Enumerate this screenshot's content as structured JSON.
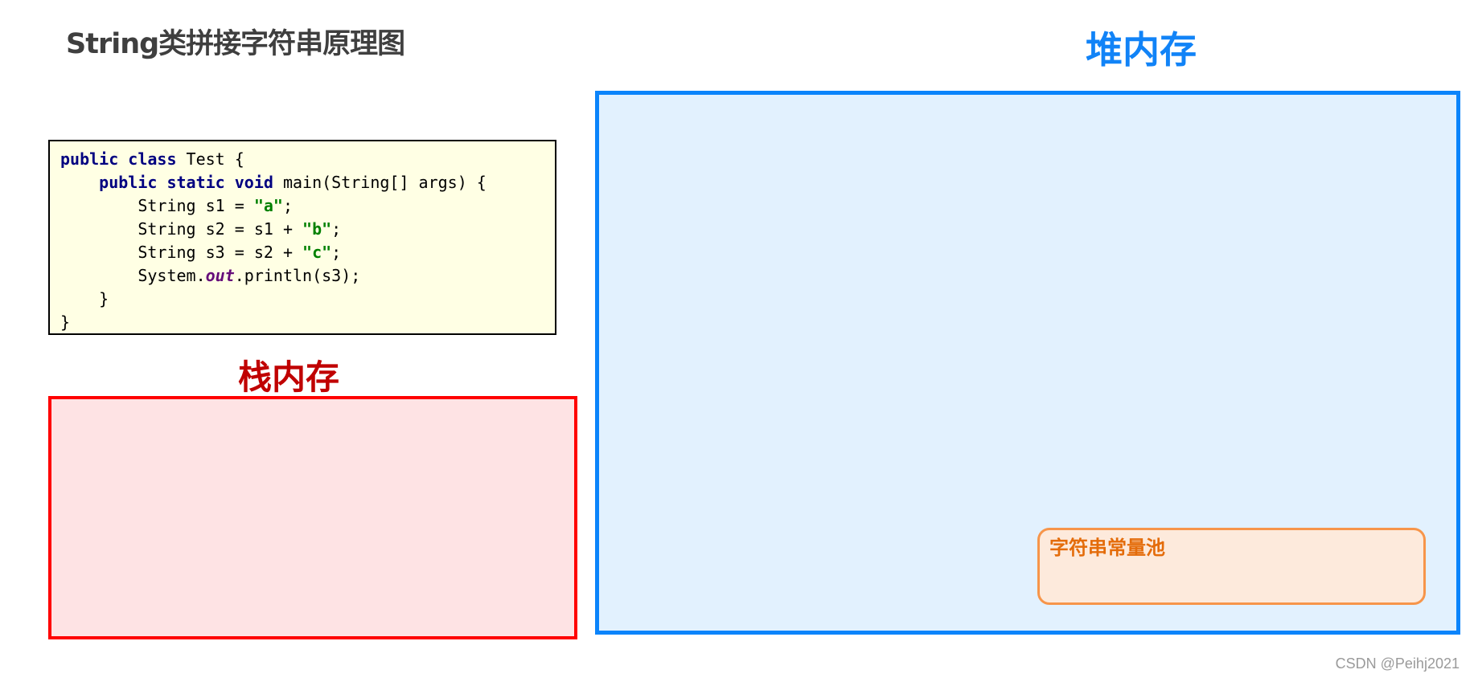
{
  "title": "String类拼接字符串原理图",
  "code": {
    "lines": [
      [
        {
          "t": "public class",
          "c": "kw"
        },
        {
          "t": " Test {",
          "c": ""
        }
      ],
      [
        {
          "t": "    ",
          "c": ""
        },
        {
          "t": "public static void",
          "c": "kw"
        },
        {
          "t": " main(String[] args) {",
          "c": ""
        }
      ],
      [
        {
          "t": "        String s1 = ",
          "c": ""
        },
        {
          "t": "\"a\"",
          "c": "str"
        },
        {
          "t": ";",
          "c": ""
        }
      ],
      [
        {
          "t": "        String s2 = s1 + ",
          "c": ""
        },
        {
          "t": "\"b\"",
          "c": "str"
        },
        {
          "t": ";",
          "c": ""
        }
      ],
      [
        {
          "t": "        String s3 = s2 + ",
          "c": ""
        },
        {
          "t": "\"c\"",
          "c": "str"
        },
        {
          "t": ";",
          "c": ""
        }
      ],
      [
        {
          "t": "        System.",
          "c": ""
        },
        {
          "t": "out",
          "c": "fld"
        },
        {
          "t": ".println(s3);",
          "c": ""
        }
      ],
      [
        {
          "t": "    }",
          "c": ""
        }
      ],
      [
        {
          "t": "}",
          "c": ""
        }
      ]
    ]
  },
  "stack": {
    "label": "栈内存",
    "color": "#ff0000"
  },
  "heap": {
    "label": "堆内存",
    "color": "#0b84fb"
  },
  "string_pool": {
    "label": "字符串常量池",
    "color": "#f7954a"
  },
  "watermark": "CSDN @Peihj2021"
}
